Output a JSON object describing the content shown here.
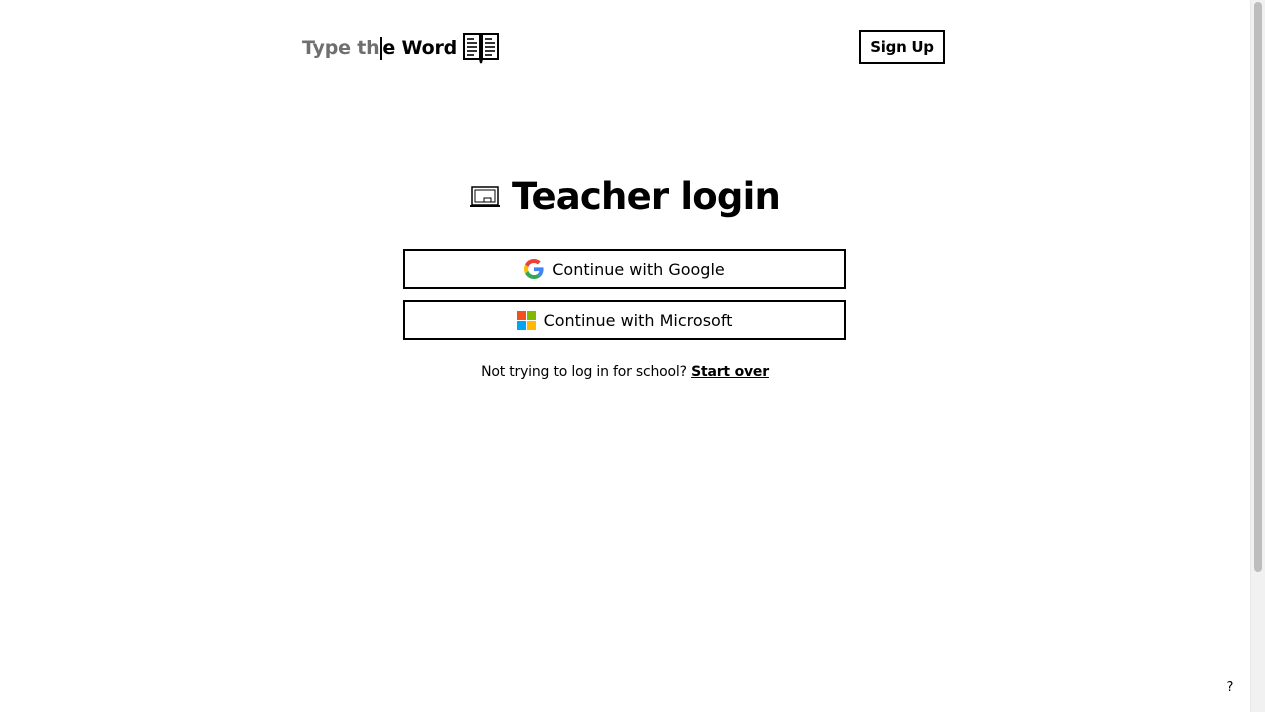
{
  "header": {
    "logo": {
      "typed_text": "Type th",
      "rest_text": "e Word",
      "icon": "open-book-icon"
    },
    "signup_label": "Sign Up"
  },
  "main": {
    "title": "Teacher login",
    "title_icon": "chalkboard-icon",
    "buttons": [
      {
        "label": "Continue with Google",
        "icon": "google-logo-icon"
      },
      {
        "label": "Continue with Microsoft",
        "icon": "microsoft-logo-icon"
      }
    ],
    "alt_prompt": "Not trying to log in for school?",
    "alt_link": "Start over"
  },
  "help_label": "?",
  "colors": {
    "google_blue": "#4285F4",
    "google_red": "#EA4335",
    "google_yellow": "#FBBC05",
    "google_green": "#34A853",
    "ms_red": "#F25022",
    "ms_green": "#7FBA00",
    "ms_blue": "#00A4EF",
    "ms_yellow": "#FFB900",
    "logo_typed_gray": "#6f6f6f"
  }
}
